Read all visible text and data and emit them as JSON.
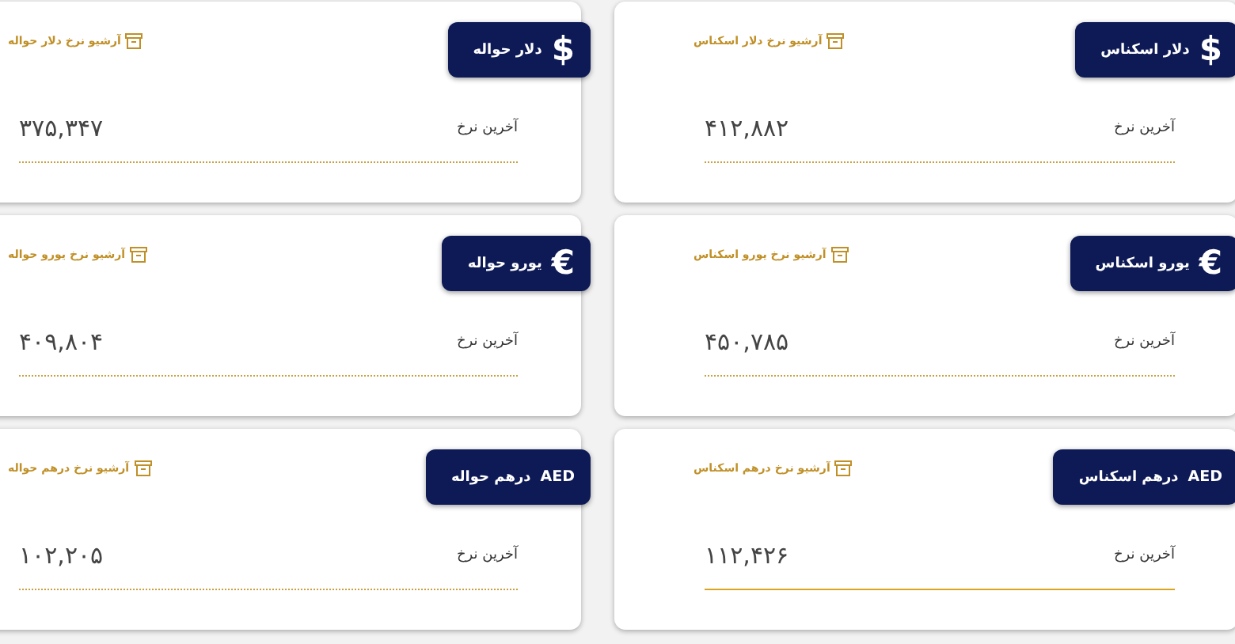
{
  "cards": [
    {
      "symbol": "$",
      "title": "دلار اسکناس",
      "archive_link": "آرشیو نرخ دلار اسکناس",
      "rate_label": "آخرین نرخ",
      "rate": "۴۱۲,۸۸۲",
      "active": false
    },
    {
      "symbol": "$",
      "title": "دلار حواله",
      "archive_link": "آرشیو نرخ دلار حواله",
      "rate_label": "آخرین نرخ",
      "rate": "۳۷۵,۳۴۷",
      "active": false
    },
    {
      "symbol": "€",
      "title": "یورو اسکناس",
      "archive_link": "آرشیو نرخ یورو اسکناس",
      "rate_label": "آخرین نرخ",
      "rate": "۴۵۰,۷۸۵",
      "active": false
    },
    {
      "symbol": "€",
      "title": "یورو حواله",
      "archive_link": "آرشیو نرخ یورو حواله",
      "rate_label": "آخرین نرخ",
      "rate": "۴۰۹,۸۰۴",
      "active": false
    },
    {
      "symbol": "AED",
      "title": "درهم اسکناس",
      "archive_link": "آرشیو نرخ درهم اسکناس",
      "rate_label": "آخرین نرخ",
      "rate": "۱۱۲,۴۲۶",
      "active": true
    },
    {
      "symbol": "AED",
      "title": "درهم حواله",
      "archive_link": "آرشیو نرخ درهم حواله",
      "rate_label": "آخرین نرخ",
      "rate": "۱۰۲,۲۰۵",
      "active": false
    }
  ]
}
